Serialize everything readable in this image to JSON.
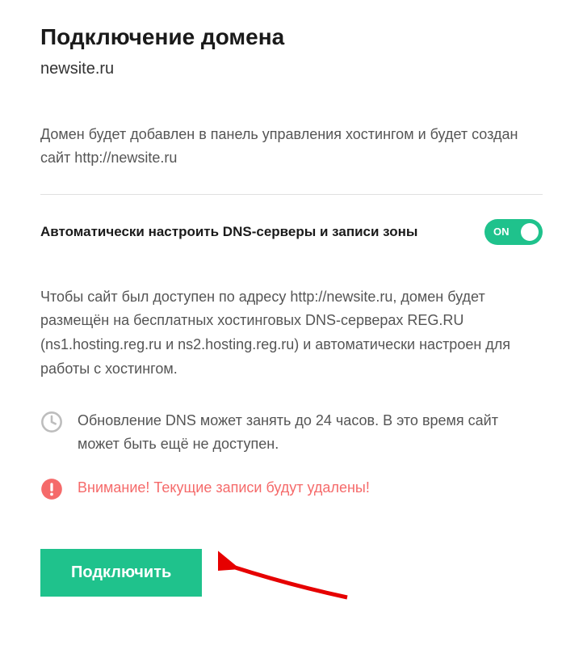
{
  "title": "Подключение домена",
  "domain_name": "newsite.ru",
  "intro_text": "Домен будет добавлен в панель управления хостингом и будет создан сайт http://newsite.ru",
  "toggle": {
    "label": "Автоматически настроить DNS-серверы и записи зоны",
    "state": "ON"
  },
  "dns_text": "Чтобы сайт был доступен по адресу http://newsite.ru, домен будет размещён на бесплатных хостинговых DNS-серверах REG.RU (ns1.hosting.reg.ru и ns2.hosting.reg.ru) и автоматически настроен для работы с хостингом.",
  "time_note": "Обновление DNS может занять до 24 часов. В это время сайт может быть ещё не доступен.",
  "warning_text": "Внимание! Текущие записи будут удалены!",
  "connect_button": "Подключить"
}
